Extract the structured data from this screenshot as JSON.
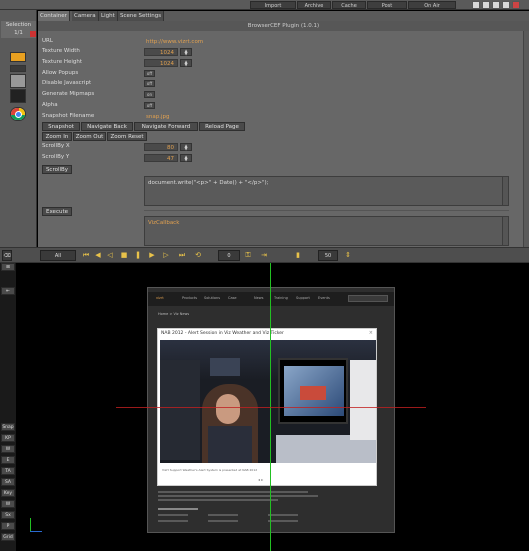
{
  "topbar": {
    "buttons": [
      "Import",
      "Archive",
      "Cache",
      "Post",
      "On Air"
    ],
    "window_icons": [
      "help-icon",
      "minimize-icon",
      "restore-icon",
      "maximize-icon",
      "close-icon"
    ]
  },
  "leftpanel": {
    "selection_label": "Selection",
    "selection_count": "1/1"
  },
  "tabs": [
    "Container",
    "Camera",
    "Light",
    "Scene Settings"
  ],
  "editor": {
    "plugin_title": "BrowserCEF Plugin (1.0.1)",
    "url_label": "URL",
    "url_value": "http://www.vizrt.com",
    "texture_width_label": "Texture Width",
    "texture_width_value": "1024",
    "texture_height_label": "Texture Height",
    "texture_height_value": "1024",
    "allow_popups_label": "Allow Popups",
    "allow_popups_value": "off",
    "disable_js_label": "Disable Javascript",
    "disable_js_value": "off",
    "mipmaps_label": "Generate Mipmaps",
    "mipmaps_value": "on",
    "alpha_label": "Alpha",
    "alpha_value": "off",
    "snapshot_filename_label": "Snapshot Filename",
    "snapshot_filename_value": "snap.jpg",
    "snapshot_btn": "Snapshot",
    "nav_back_btn": "Navigate Back",
    "nav_forward_btn": "Navigate Forward",
    "reload_btn": "Reload Page",
    "zoom_in_btn": "Zoom In",
    "zoom_out_btn": "Zoom Out",
    "zoom_reset_btn": "Zoom Reset",
    "scrollby_x_label": "ScrollBy X",
    "scrollby_x_value": "80",
    "scrollby_y_label": "ScrollBy Y",
    "scrollby_y_value": "47",
    "scrollby_btn": "ScrollBy",
    "script_text": "document.write(\"<p>\" + Date() + \"</p>\");",
    "execute_btn": "Execute",
    "callback_text": "VizCallback"
  },
  "toolbar": {
    "layer_label": "All",
    "frame_value": "0",
    "fps_value": "50"
  },
  "sidebar": {
    "buttons": [
      "Snap",
      "KP",
      "W",
      "E",
      "TA",
      "SA",
      "Key",
      "W",
      "Sx",
      "P",
      "Grid"
    ]
  },
  "browser_page": {
    "nav_items": [
      "vizrt",
      "Products",
      "Solutions",
      "Case",
      "News",
      "Training",
      "Support",
      "Events"
    ],
    "breadcrumb": "Home > Viz News",
    "video_title": "NAB 2012 - Alert Session in Viz Weather and Viz Ticker",
    "close_glyph": "×",
    "video_controls": "◂ ▸",
    "caption": "Vizrt Support Weather's Alert System is presented at NAB 2012"
  },
  "colors": {
    "accent_text": "#e0a050",
    "crosshair_v": "#22c022",
    "crosshair_h": "#c02020",
    "panel_bg": "#676767"
  }
}
